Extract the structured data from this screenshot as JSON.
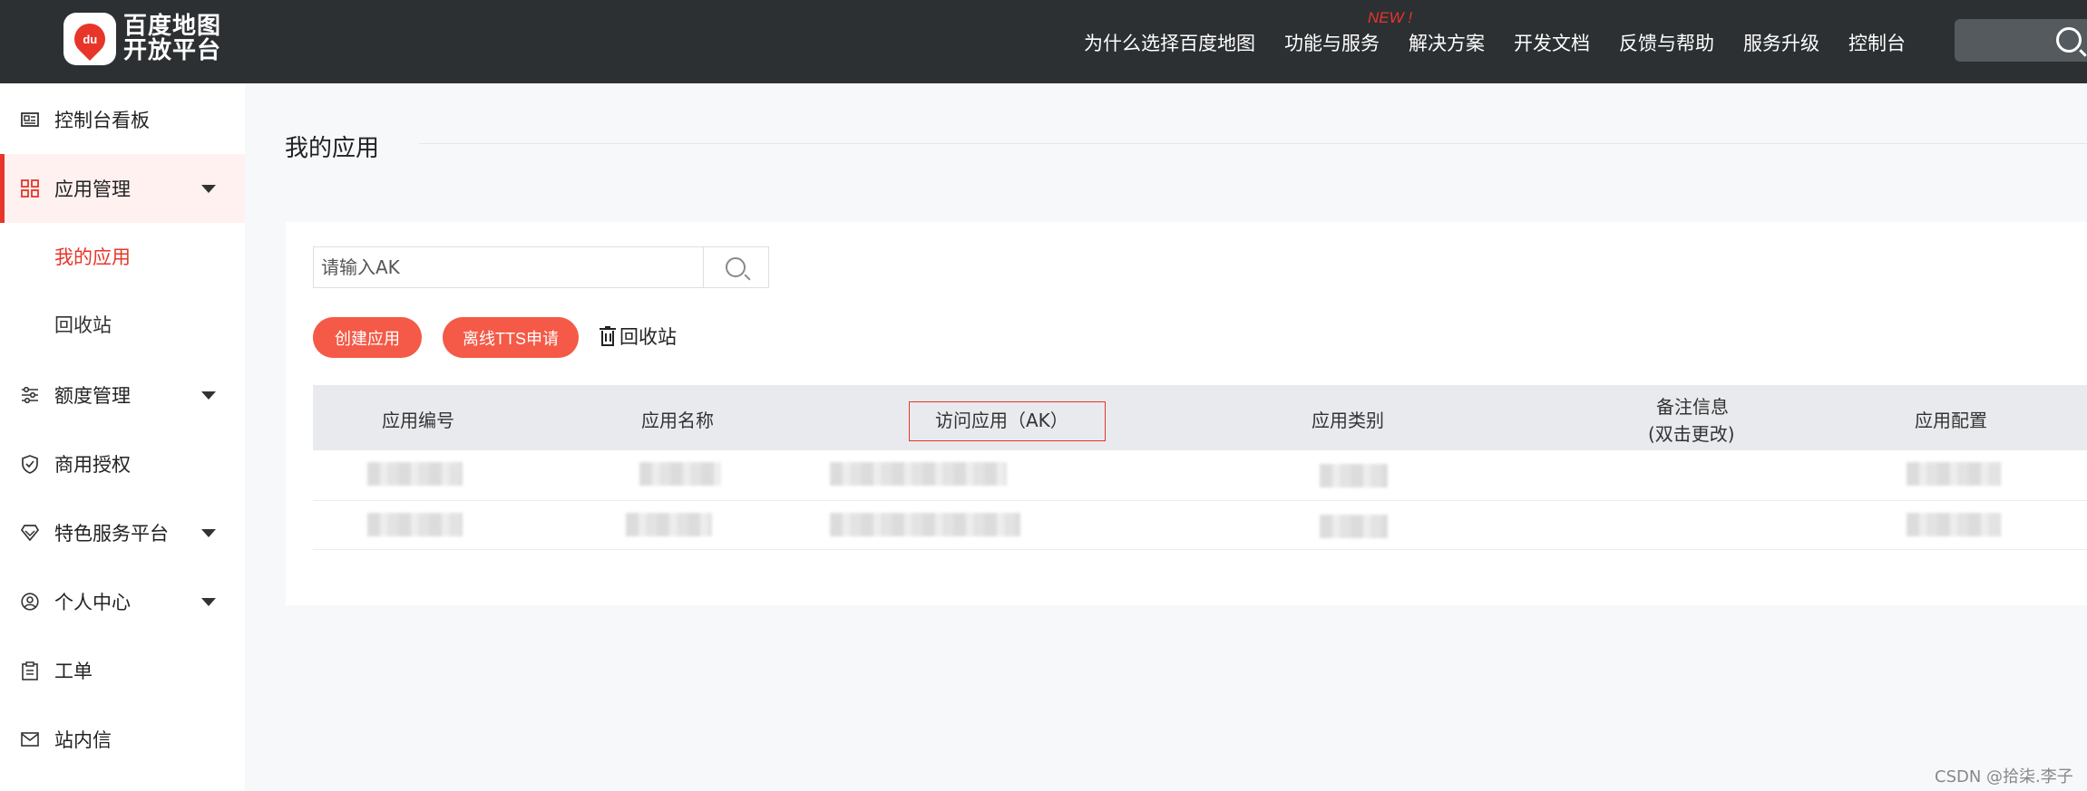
{
  "header": {
    "logo_badge": "du",
    "logo_line1": "百度地图",
    "logo_line2": "开放平台",
    "nav": [
      {
        "label": "为什么选择百度地图"
      },
      {
        "label": "功能与服务",
        "badge": "NEW !"
      },
      {
        "label": "解决方案"
      },
      {
        "label": "开发文档"
      },
      {
        "label": "反馈与帮助"
      },
      {
        "label": "服务升级"
      },
      {
        "label": "控制台"
      }
    ]
  },
  "sidebar": {
    "items": [
      {
        "label": "控制台看板",
        "icon": "dashboard-card-icon"
      },
      {
        "label": "应用管理",
        "icon": "grid-icon",
        "expanded": true
      },
      {
        "label": "额度管理",
        "icon": "sliders-icon"
      },
      {
        "label": "商用授权",
        "icon": "shield-check-icon"
      },
      {
        "label": "特色服务平台",
        "icon": "diamond-icon"
      },
      {
        "label": "个人中心",
        "icon": "user-circle-icon"
      },
      {
        "label": "工单",
        "icon": "clipboard-icon"
      },
      {
        "label": "站内信",
        "icon": "mail-icon"
      }
    ],
    "sub_items": [
      {
        "label": "我的应用",
        "current": true
      },
      {
        "label": "回收站"
      }
    ]
  },
  "main": {
    "page_title": "我的应用",
    "search": {
      "placeholder": "请输入AK"
    },
    "buttons": {
      "create": "创建应用",
      "tts": "离线TTS申请",
      "recycle": "回收站"
    },
    "table": {
      "columns": [
        "应用编号",
        "应用名称",
        "访问应用（AK）",
        "应用类别",
        "备注信息",
        "(双击更改)",
        "应用配置"
      ],
      "rows": 2
    }
  },
  "watermark": "CSDN @拾柒.李子",
  "colors": {
    "accent": "#e8352a",
    "button": "#f45a47",
    "topbar": "#2c3033"
  }
}
